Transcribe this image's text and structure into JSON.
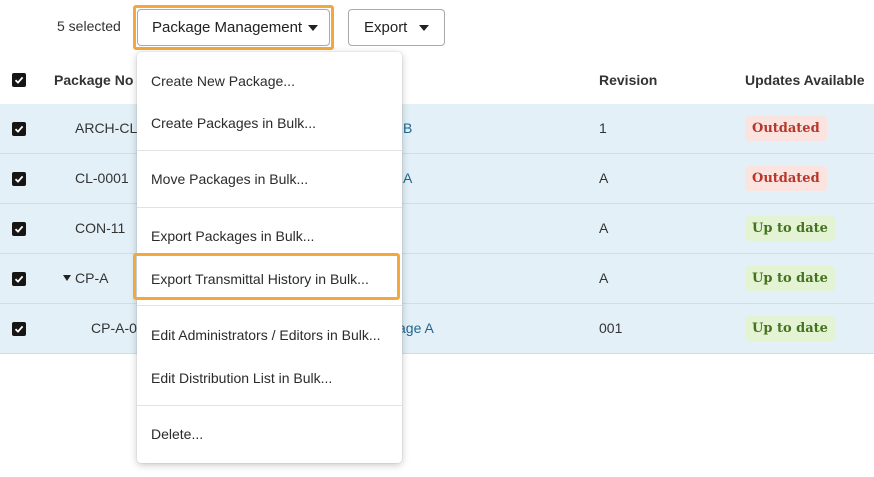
{
  "toolbar": {
    "selected_count": "5 selected",
    "package_management_label": "Package Management",
    "export_label": "Export"
  },
  "table": {
    "columns": [
      "Package No",
      "Revision",
      "Updates Available"
    ],
    "rows": [
      {
        "package_no": "ARCH-CL-",
        "title_fragment": "B",
        "revision": "1",
        "status": "Outdated",
        "selected": true
      },
      {
        "package_no": "CL-0001",
        "title_fragment": "A",
        "revision": "A",
        "status": "Outdated",
        "selected": true
      },
      {
        "package_no": "CON-11",
        "title_fragment": "",
        "revision": "A",
        "status": "Up to date",
        "selected": true
      },
      {
        "package_no": "CP-A",
        "title_fragment": "",
        "revision": "A",
        "status": "Up to date",
        "selected": true,
        "expanded": true
      },
      {
        "package_no": "CP-A-0",
        "title_fragment": "age A",
        "revision": "001",
        "status": "Up to date",
        "selected": true
      }
    ]
  },
  "menu": {
    "items": [
      "Create New Package...",
      "Create Packages in Bulk...",
      "Move Packages in Bulk...",
      "Export Packages in Bulk...",
      "Export Transmittal History in Bulk...",
      "Edit Administrators / Editors in Bulk...",
      "Edit Distribution List in Bulk...",
      "Delete..."
    ],
    "highlighted_item": "Export Transmittal History in Bulk..."
  },
  "colors": {
    "row_selected_bg": "#e3f0f8",
    "focus_ring": "#f2a83c",
    "link": "#22668e",
    "outdated_bg": "#fbe3e0",
    "outdated_text": "#b6382a",
    "uptodate_bg": "#e3f3d3",
    "uptodate_text": "#44721e"
  }
}
